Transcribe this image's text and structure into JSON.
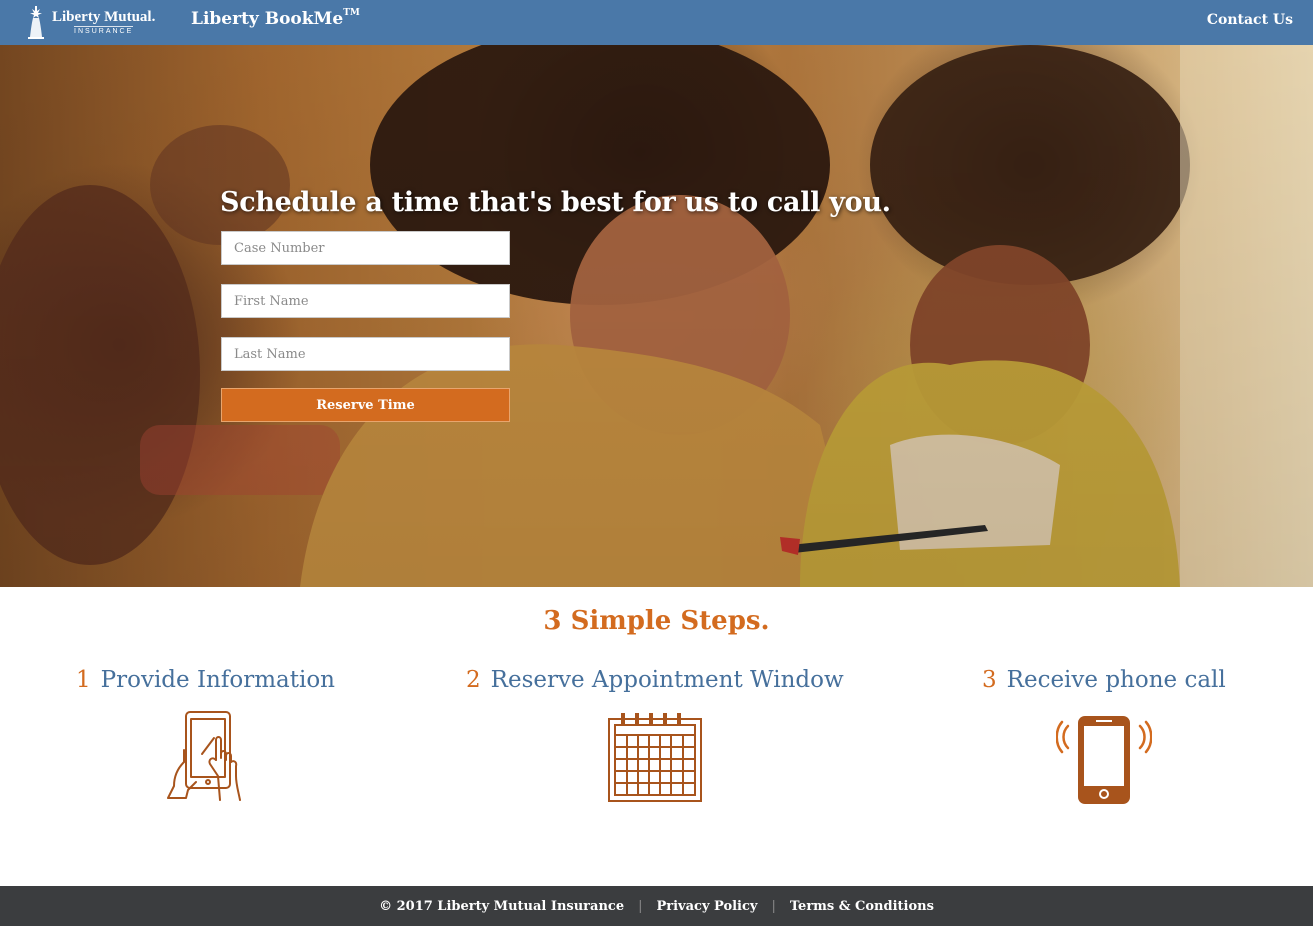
{
  "header": {
    "logo_name": "Liberty Mutual.",
    "logo_sub": "INSURANCE",
    "app_name": "Liberty BookMe",
    "app_tm": "TM",
    "contact_label": "Contact Us"
  },
  "hero": {
    "title": "Schedule a time that's best for us to call you.",
    "form": {
      "case_number_placeholder": "Case Number",
      "first_name_placeholder": "First Name",
      "last_name_placeholder": "Last Name",
      "reserve_label": "Reserve Time"
    }
  },
  "steps": {
    "title": "3 Simple Steps.",
    "items": [
      {
        "number": "1",
        "label": "Provide Information",
        "icon": "tablet-hands-icon"
      },
      {
        "number": "2",
        "label": "Reserve Appointment Window",
        "icon": "calendar-icon"
      },
      {
        "number": "3",
        "label": "Receive phone call",
        "icon": "ringing-phone-icon"
      }
    ]
  },
  "footer": {
    "copyright": "© 2017 Liberty Mutual Insurance",
    "privacy": "Privacy Policy",
    "terms": "Terms & Conditions"
  },
  "colors": {
    "header_bg": "#4a78a8",
    "accent_orange": "#d36b1f",
    "step_blue": "#46709c",
    "footer_bg": "#3b3d3f"
  }
}
